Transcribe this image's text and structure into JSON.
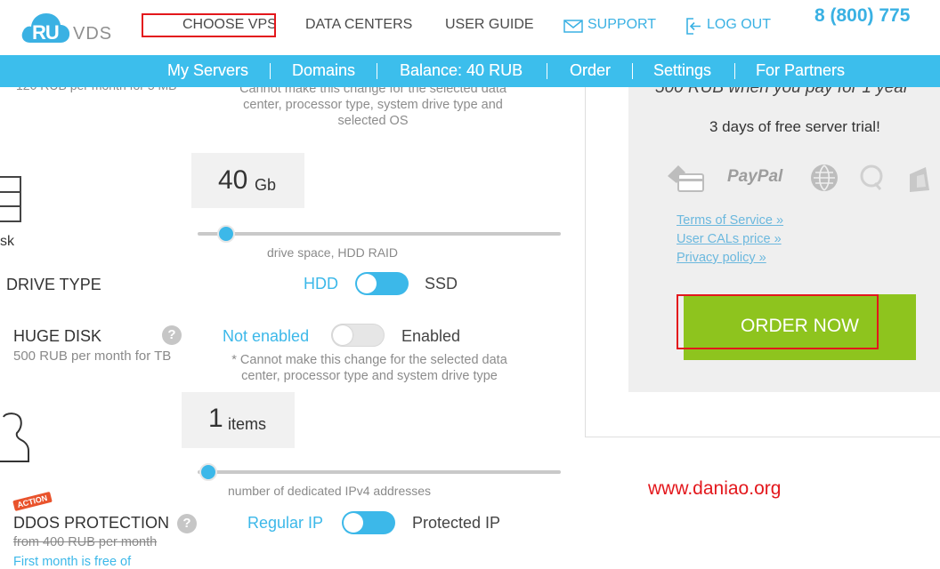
{
  "header": {
    "logo_ru": "RU",
    "logo_vds": "VDS",
    "nav_choose": "CHOOSE VPS",
    "nav_datacenters": "DATA CENTERS",
    "nav_guide": "USER GUIDE",
    "nav_support": "SUPPORT",
    "nav_logout": "LOG OUT",
    "phone": "8 (800) 775"
  },
  "menu": {
    "servers": "My Servers",
    "domains": "Domains",
    "balance": "Balance: 40 RUB",
    "order": "Order",
    "settings": "Settings",
    "partners": "For Partners"
  },
  "config": {
    "cut_left_text": "120 RUB per month for 5 MB",
    "top_note": "Cannot make this change for the selected data center, processor type, system drive type and selected OS",
    "disk_value": "40",
    "disk_unit": "Gb",
    "disk_level": 0.05,
    "disk_icon_label": "sk",
    "disk_caption": "drive space, HDD RAID",
    "drive_type_label": "DRIVE TYPE",
    "drive_hdd": "HDD",
    "drive_ssd": "SSD",
    "huge_disk_label": "HUGE DISK",
    "huge_disk_price": "500 RUB per month for TB",
    "huge_not_enabled": "Not enabled",
    "huge_enabled": "Enabled",
    "huge_note": "* Cannot make this change for the selected data center, processor type and system drive type",
    "ip_value": "1",
    "ip_unit": "items",
    "ip_level": 0.0,
    "ip_caption": "number of dedicated IPv4 addresses",
    "ddos_badge": "ACTION",
    "ddos_label": "DDOS PROTECTION",
    "ddos_old_price": "from 400 RUB per month",
    "ddos_free": "First month is free of",
    "ddos_regular": "Regular IP",
    "ddos_protected": "Protected IP"
  },
  "panel": {
    "cut_offer": "500 RUB when you pay for 1 year",
    "trial": "3 days of free server trial!",
    "paypal": "PayPal",
    "terms": "Terms of Service »",
    "cals": "User CALs price »",
    "privacy": "Privacy policy »",
    "order_now": "ORDER NOW"
  },
  "watermark": "www.daniao.org",
  "colors": {
    "accent": "#3cbeec",
    "order_green": "#8ec41e",
    "highlight_red": "#e3171c"
  }
}
